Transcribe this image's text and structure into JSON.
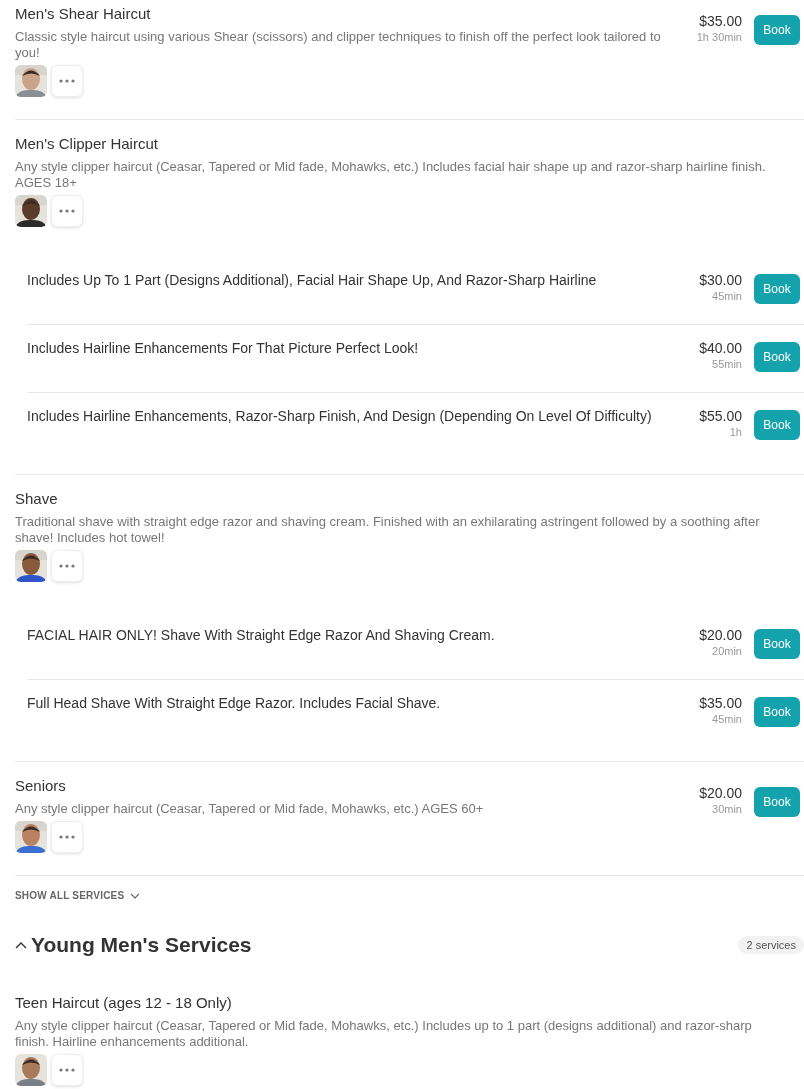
{
  "services": [
    {
      "title": "Men's Shear Haircut",
      "description": "Classic style haircut using various Shear (scissors) and clipper techniques to finish off the perfect look tailored to you!",
      "price": "$35.00",
      "duration": "1h 30min",
      "book": "Book"
    },
    {
      "title": "Men's Clipper Haircut",
      "description": "Any style clipper haircut (Ceasar, Tapered or Mid fade, Mohawks, etc.) Includes facial hair shape up and razor-sharp hairline finish. AGES 18+",
      "variants": [
        {
          "description": "Includes Up To 1 Part (Designs Additional), Facial Hair Shape Up, And Razor-Sharp Hairline",
          "price": "$30.00",
          "duration": "45min",
          "book": "Book"
        },
        {
          "description": "Includes Hairline Enhancements For That Picture Perfect Look!",
          "price": "$40.00",
          "duration": "55min",
          "book": "Book"
        },
        {
          "description": "Includes Hairline Enhancements, Razor-Sharp Finish, And Design (Depending On Level Of Difficulty)",
          "price": "$55.00",
          "duration": "1h",
          "book": "Book"
        }
      ]
    },
    {
      "title": "Shave",
      "description": "Traditional shave with straight edge razor and shaving cream. Finished with an exhilarating astringent followed by a soothing after shave! Includes hot towel!",
      "variants": [
        {
          "description": "FACIAL HAIR ONLY! Shave With Straight Edge Razor And Shaving Cream.",
          "price": "$20.00",
          "duration": "20min",
          "book": "Book"
        },
        {
          "description": "Full Head Shave With Straight Edge Razor. Includes Facial Shave.",
          "price": "$35.00",
          "duration": "45min",
          "book": "Book"
        }
      ]
    },
    {
      "title": "Seniors",
      "description": "Any style clipper haircut (Ceasar, Tapered or Mid fade, Mohawks, etc.) AGES 60+",
      "price": "$20.00",
      "duration": "30min",
      "book": "Book"
    }
  ],
  "show_all": "SHOW ALL SERVICES",
  "category": {
    "title": "Young Men's Services",
    "expanded": true,
    "count": "2 services",
    "services": [
      {
        "title": "Teen Haircut (ages 12 - 18 Only)",
        "description": "Any style clipper haircut (Ceasar, Tapered or Mid fade, Mohawks, etc.) Includes up to 1 part (designs additional) and razor-sharp finish. Hairline enhancements additional."
      }
    ]
  }
}
